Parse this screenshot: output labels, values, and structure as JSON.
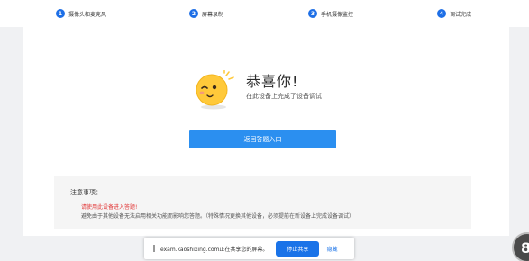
{
  "steps": [
    {
      "num": "1",
      "label": "摄像头和麦克风"
    },
    {
      "num": "2",
      "label": "屏幕录制"
    },
    {
      "num": "3",
      "label": "手机摄像监控"
    },
    {
      "num": "4",
      "label": "调试完成"
    }
  ],
  "result": {
    "title": "恭喜你!",
    "subtitle": "在此设备上完成了设备调试",
    "return_button": "返回答题入口"
  },
  "notice": {
    "title": "注意事项：",
    "warning": "请使用此设备进入答题!",
    "detail": "避免由于其他设备无法启用相关功能而影响您答题。（特殊情况更换其他设备，必须提前在新设备上完成设备调试）"
  },
  "share_bar": {
    "message": "exam.kaoshixing.com正在共享您的屏幕。",
    "stop_button": "停止共享",
    "hide_link": "隐藏"
  },
  "corner_badge": "8",
  "colors": {
    "step_accent": "#1e6fe6",
    "primary_button": "#2b8ff0",
    "warning_text": "#e23b3b"
  }
}
